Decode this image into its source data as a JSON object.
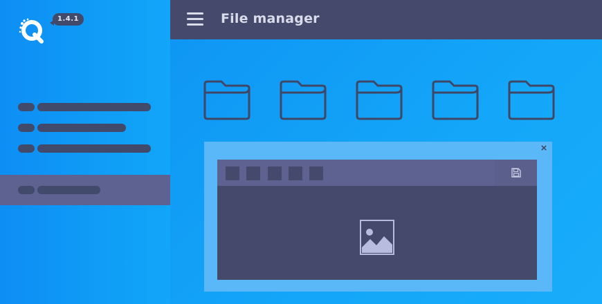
{
  "app": {
    "version": "1.4.1",
    "title": "File manager"
  },
  "colors": {
    "brand_blue": "#10a4f8",
    "dark_navy": "#454a6c",
    "active_purple": "#5d6290",
    "dialog_light": "#5bb8f8"
  },
  "sidebar": {
    "items": [
      {
        "name": "sidebar-item-1",
        "active": false
      },
      {
        "name": "sidebar-item-2",
        "active": false
      },
      {
        "name": "sidebar-item-3",
        "active": false
      },
      {
        "name": "sidebar-item-4",
        "active": true
      }
    ]
  },
  "folders": [
    {
      "name": "folder-1",
      "icon": "folder-icon"
    },
    {
      "name": "folder-2",
      "icon": "folder-icon"
    },
    {
      "name": "folder-3",
      "icon": "folder-icon"
    },
    {
      "name": "folder-4",
      "icon": "folder-icon"
    },
    {
      "name": "folder-5",
      "icon": "folder-icon"
    }
  ],
  "dialog": {
    "close_glyph": "×",
    "toolbar_buttons": 5,
    "save_icon": "save-icon",
    "content_icon": "image-placeholder-icon"
  }
}
